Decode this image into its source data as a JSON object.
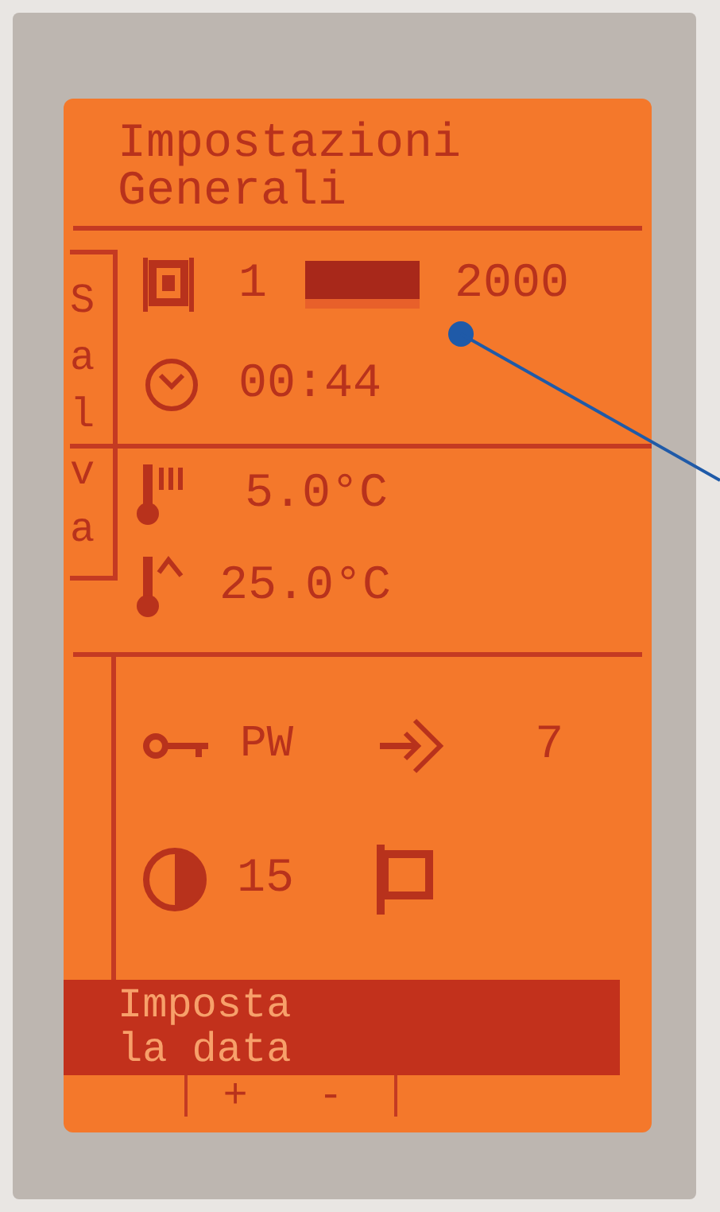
{
  "title": {
    "lines": [
      "Impostazioni",
      "Generali"
    ]
  },
  "side_tab": {
    "label": "Salva"
  },
  "date": {
    "day": "1",
    "month_field": {
      "selected": true
    },
    "year": "2000"
  },
  "time": {
    "value": "00:44"
  },
  "temperatures": [
    {
      "kind": "min",
      "value": "5.0°C"
    },
    {
      "kind": "max",
      "value": "25.0°C"
    }
  ],
  "password": {
    "label": "PW"
  },
  "address": {
    "value": "7"
  },
  "contrast": {
    "value": "15"
  },
  "message": {
    "lines": [
      "Imposta",
      "la data"
    ]
  },
  "softkeys": [
    "+",
    "-"
  ]
}
